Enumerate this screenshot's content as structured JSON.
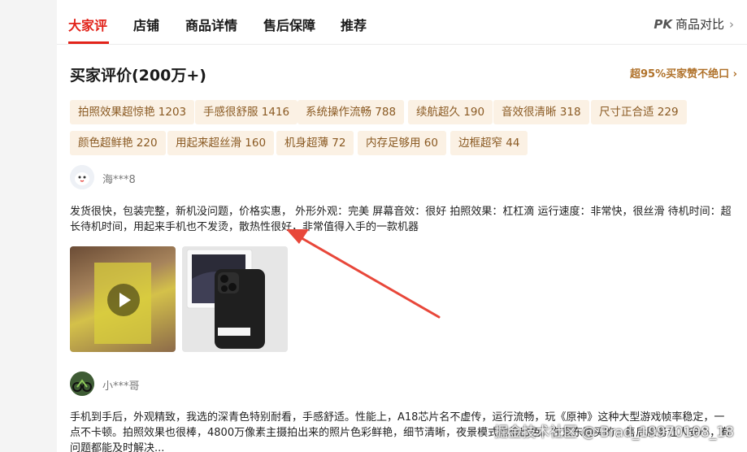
{
  "tabs": [
    {
      "label": "大家评"
    },
    {
      "label": "店铺"
    },
    {
      "label": "商品详情"
    },
    {
      "label": "售后保障"
    },
    {
      "label": "推荐"
    }
  ],
  "compare": {
    "pk": "PK",
    "label": "商品对比",
    "chevron": "›"
  },
  "section_title": "买家评价(200万+)",
  "praise_link": "超95%买家赞不绝口 ›",
  "tags": [
    "拍照效果超惊艳 1203",
    "手感很舒服 1416",
    "系统操作流畅 788",
    "续航超久 190",
    "音效很清晰 318",
    "尺寸正合适 229",
    "颜色超鲜艳 220",
    "用起来超丝滑 160",
    "机身超薄 72",
    "内存足够用 60",
    "边框超窄 44"
  ],
  "reviews": [
    {
      "user": "海***8",
      "text": "发货很快，包装完整，新机没问题，价格实惠， 外形外观：完美 屏幕音效：很好 拍照效果：杠杠滴 运行速度：非常快，很丝滑 待机时间：超长待机时间，用起来手机也不发烫，散热性很好，非常值得入手的一款机器",
      "media": [
        {
          "kind": "video"
        },
        {
          "kind": "image"
        }
      ]
    },
    {
      "user": "小***哥",
      "text": "手机到手后，外观精致，我选的深青色特别耐看，手感舒适。性能上，A18芯片名不虚传，运行流畅，玩《原神》这种大型游戏帧率稳定，一点不卡顿。拍照效果也很棒，4800万像素主摄拍出来的照片色彩鲜艳，细节清晰，夜景模式也很出色。在京东购买的，售后服务让人安心，有问题都能及时解决..."
    }
  ],
  "watermark": "掘金技术社区 @ Brad_19970108_18",
  "colors": {
    "accent": "#e2231a",
    "tag_bg": "#fbf1e4",
    "tag_text": "#8a5a23",
    "praise": "#b0722b",
    "annotation_arrow": "#e8473a"
  },
  "icons": [
    "chevron-right-icon",
    "play-icon",
    "avatar-icon",
    "annotation-arrow"
  ]
}
